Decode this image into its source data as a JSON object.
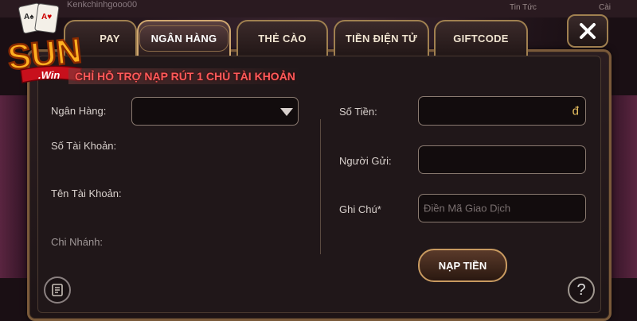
{
  "brand": {
    "logo_text": "SUN",
    "logo_sub": ".Win"
  },
  "background": {
    "top_left_text": "Kenkchinhgooo00",
    "top_right_text_1": "Tin Tức",
    "top_right_text_2": "Cài"
  },
  "tabs": [
    {
      "label": "PAY",
      "active": false
    },
    {
      "label": "NGÂN HÀNG",
      "active": true
    },
    {
      "label": "THẺ CÀO",
      "active": false
    },
    {
      "label": "TIỀN ĐIỆN TỬ",
      "active": false
    },
    {
      "label": "GIFTCODE",
      "active": false
    }
  ],
  "close": {
    "icon": "close-icon",
    "label": "✕"
  },
  "notice": "CHỈ HỖ TRỢ NẠP RÚT 1 CHỦ TÀI KHOẢN",
  "form": {
    "bank_label": "Ngân Hàng:",
    "bank_value": "",
    "account_number_label": "Số Tài Khoản:",
    "account_name_label": "Tên Tài Khoản:",
    "branch_label": "Chi Nhánh:",
    "amount_label": "Số Tiền:",
    "amount_value": "",
    "currency_symbol": "đ",
    "sender_label": "Người Gửi:",
    "sender_value": "",
    "note_label": "Ghi Chú*",
    "note_placeholder": "Điền Mã Giao Dịch"
  },
  "submit_label": "NẠP TIỀN",
  "help_label": "?",
  "colors": {
    "accent_gold": "#c89a60",
    "notice_red": "#ff5a5a",
    "currency": "#e8c060"
  }
}
